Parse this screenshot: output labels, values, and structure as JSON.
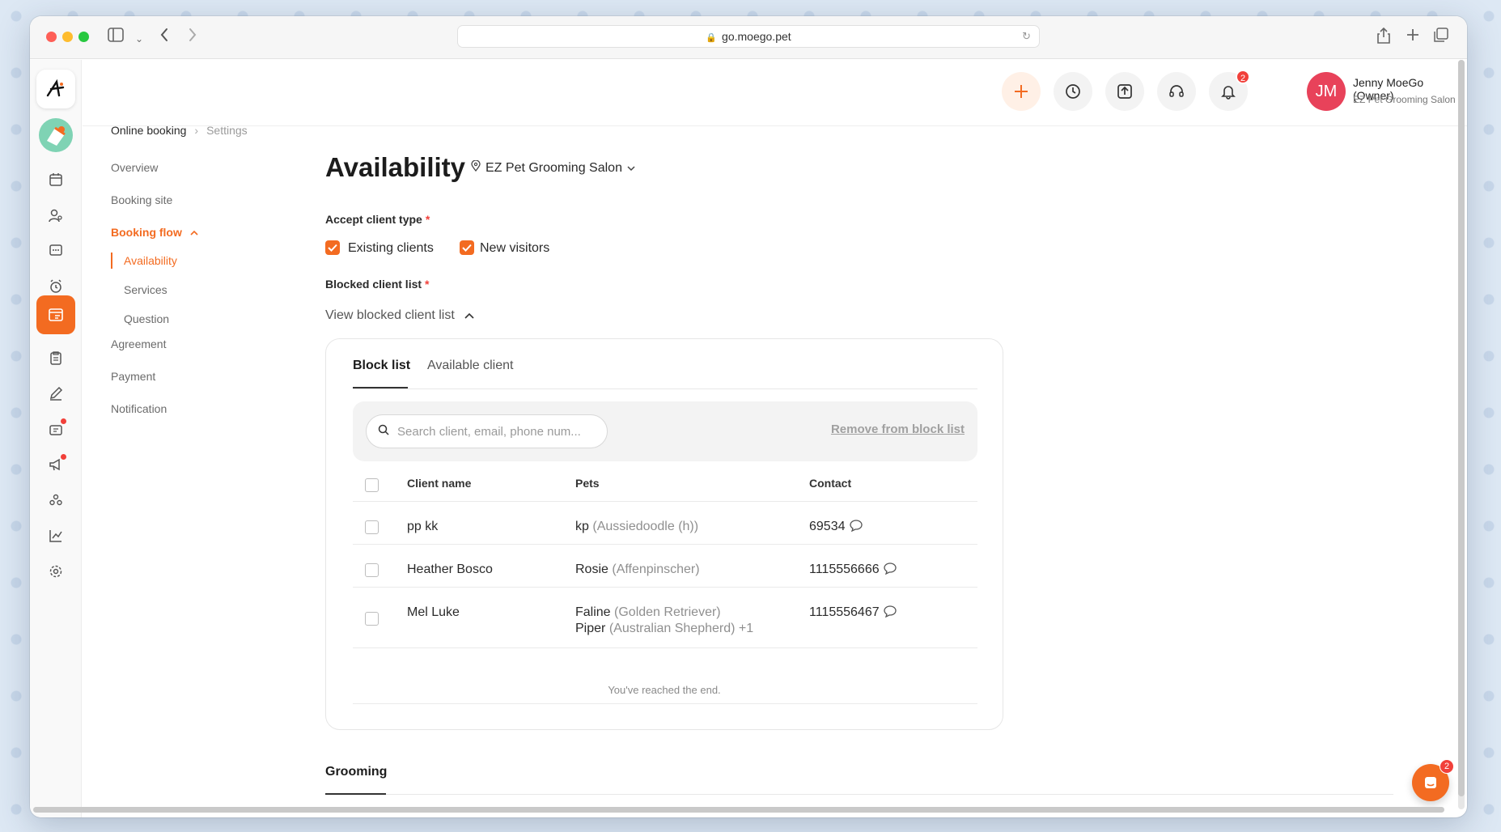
{
  "browser": {
    "url": "go.moego.pet"
  },
  "header": {
    "user_initials": "JM",
    "user_name": "Jenny MoeGo (Owner)",
    "user_business": "EZ Pet Grooming Salon",
    "notification_count": "2"
  },
  "breadcrumb": {
    "parent": "Online booking",
    "current": "Settings"
  },
  "settings_nav": {
    "overview": "Overview",
    "booking_site": "Booking site",
    "booking_flow": "Booking flow",
    "availability": "Availability",
    "services": "Services",
    "question": "Question",
    "agreement": "Agreement",
    "payment": "Payment",
    "notification": "Notification"
  },
  "main": {
    "title": "Availability",
    "location": "EZ Pet Grooming Salon",
    "accept_client_type_label": "Accept client type",
    "existing_clients": "Existing clients",
    "new_visitors": "New visitors",
    "blocked_list_label": "Blocked client list",
    "view_blocked_list": "View blocked client list",
    "required_mark": "*"
  },
  "blocklist": {
    "tabs": {
      "block_list": "Block list",
      "available_client": "Available client"
    },
    "search_placeholder": "Search client, email, phone num...",
    "remove_label": "Remove from block list",
    "columns": {
      "client_name": "Client name",
      "pets": "Pets",
      "contact": "Contact"
    },
    "rows": [
      {
        "name": "pp kk",
        "pet1": "kp",
        "pet1_breed": "(Aussiedoodle (h))",
        "contact": "69534"
      },
      {
        "name": "Heather Bosco",
        "pet1": "Rosie",
        "pet1_breed": "(Affenpinscher)",
        "contact": "1115556666"
      },
      {
        "name": "Mel Luke",
        "pet1": "Faline",
        "pet1_breed": "(Golden Retriever)",
        "pet2": "Piper",
        "pet2_breed": "(Australian Shepherd) +1",
        "contact": "1115556467"
      }
    ],
    "end_text": "You've reached the end."
  },
  "section": {
    "grooming": "Grooming"
  },
  "chat": {
    "badge": "2"
  },
  "colors": {
    "accent": "#f36b21",
    "danger": "#f1403a",
    "avatar": "#e8425a"
  }
}
